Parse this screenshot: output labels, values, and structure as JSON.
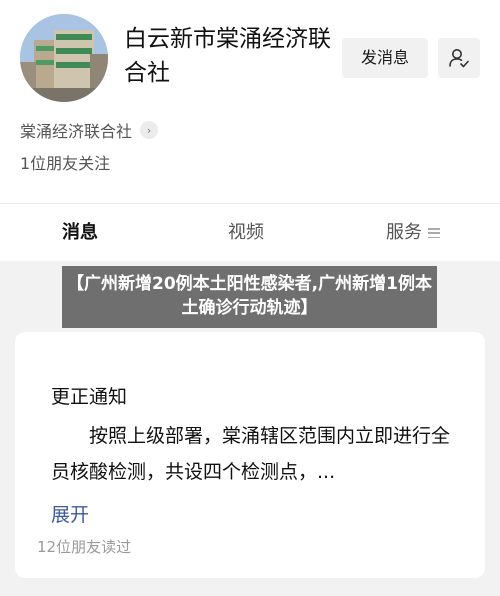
{
  "account": {
    "name": "白云新市棠涌经济联合社",
    "send_message_label": "发消息",
    "org_label": "棠涌经济联合社",
    "friends_follow": "1位朋友关注"
  },
  "tabs": [
    {
      "label": "消息"
    },
    {
      "label": "视频"
    },
    {
      "label": "服务"
    }
  ],
  "headline": "【广州新增20例本土阳性感染者,广州新增1例本土确诊行动轨迹】",
  "card": {
    "title": "更正通知",
    "body": "按照上级部署，棠涌辖区范围内立即进行全员核酸检测，共设四个检测点，...",
    "expand_label": "展开",
    "readers": "12位朋友读过"
  },
  "colors": {
    "background": "#f2f2f2",
    "card": "#ffffff",
    "link": "#3c5aa0",
    "headline_bg": "#6f6f6f"
  },
  "icons": {
    "follow": "user-check-icon",
    "org_chevron": "chevron-right-icon",
    "service_menu": "menu-icon"
  }
}
